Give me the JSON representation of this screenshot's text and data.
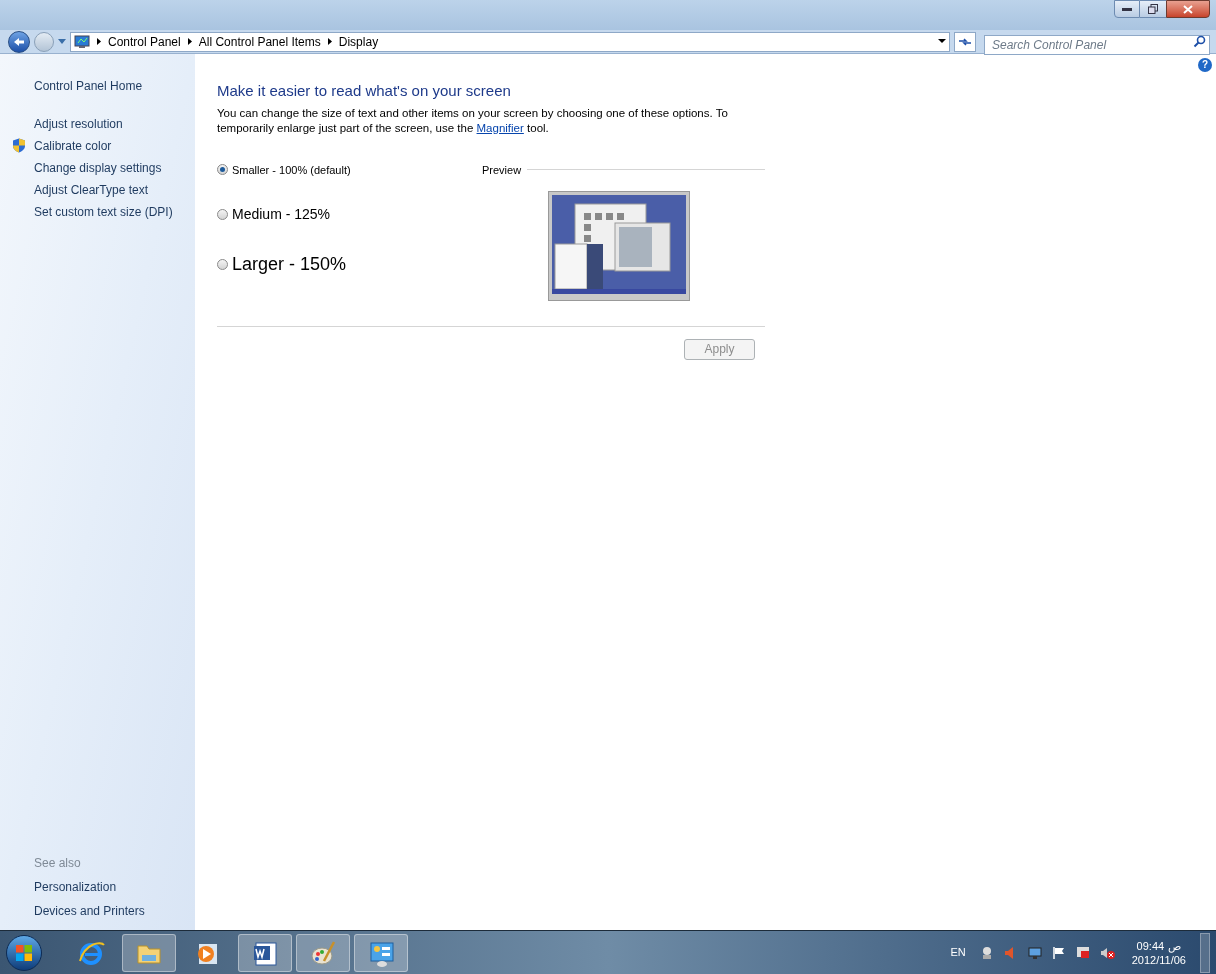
{
  "address_bar": {
    "breadcrumbs": [
      "Control Panel",
      "All Control Panel Items",
      "Display"
    ]
  },
  "search": {
    "placeholder": "Search Control Panel"
  },
  "help_button": "?",
  "sidebar": {
    "home": "Control Panel Home",
    "items": [
      {
        "label": "Adjust resolution",
        "kind": "plain"
      },
      {
        "label": "Calibrate color",
        "kind": "shield"
      },
      {
        "label": "Change display settings",
        "kind": "plain"
      },
      {
        "label": "Adjust ClearType text",
        "kind": "plain"
      },
      {
        "label": "Set custom text size (DPI)",
        "kind": "plain"
      }
    ],
    "see_also": {
      "title": "See also",
      "items": [
        "Personalization",
        "Devices and Printers"
      ]
    }
  },
  "main": {
    "heading": "Make it easier to read what's on your screen",
    "description": {
      "before": "You can change the size of text and other items on your screen by choosing one of these options. To temporarily enlarge just part of the screen, use the",
      "link": "Magnifier",
      "after": "tool."
    },
    "options": [
      {
        "label": "Smaller - 100% (default)",
        "kind": "small",
        "selected": true
      },
      {
        "label": "Medium - 125%",
        "kind": "medium",
        "selected": false
      },
      {
        "label": "Larger - 150%",
        "kind": "large",
        "selected": false
      }
    ],
    "preview_label": "Preview",
    "apply_button": {
      "label": "Apply",
      "disabled": true
    }
  },
  "taskbar": {
    "apps": [
      {
        "kind": "ie",
        "running": false
      },
      {
        "kind": "explorer",
        "running": true
      },
      {
        "kind": "media",
        "running": false
      },
      {
        "kind": "word",
        "running": true
      },
      {
        "kind": "paint",
        "running": true
      },
      {
        "kind": "control",
        "running": true
      }
    ],
    "language": "EN",
    "time": "09:44",
    "period": "ص",
    "date": "2012/11/06"
  }
}
